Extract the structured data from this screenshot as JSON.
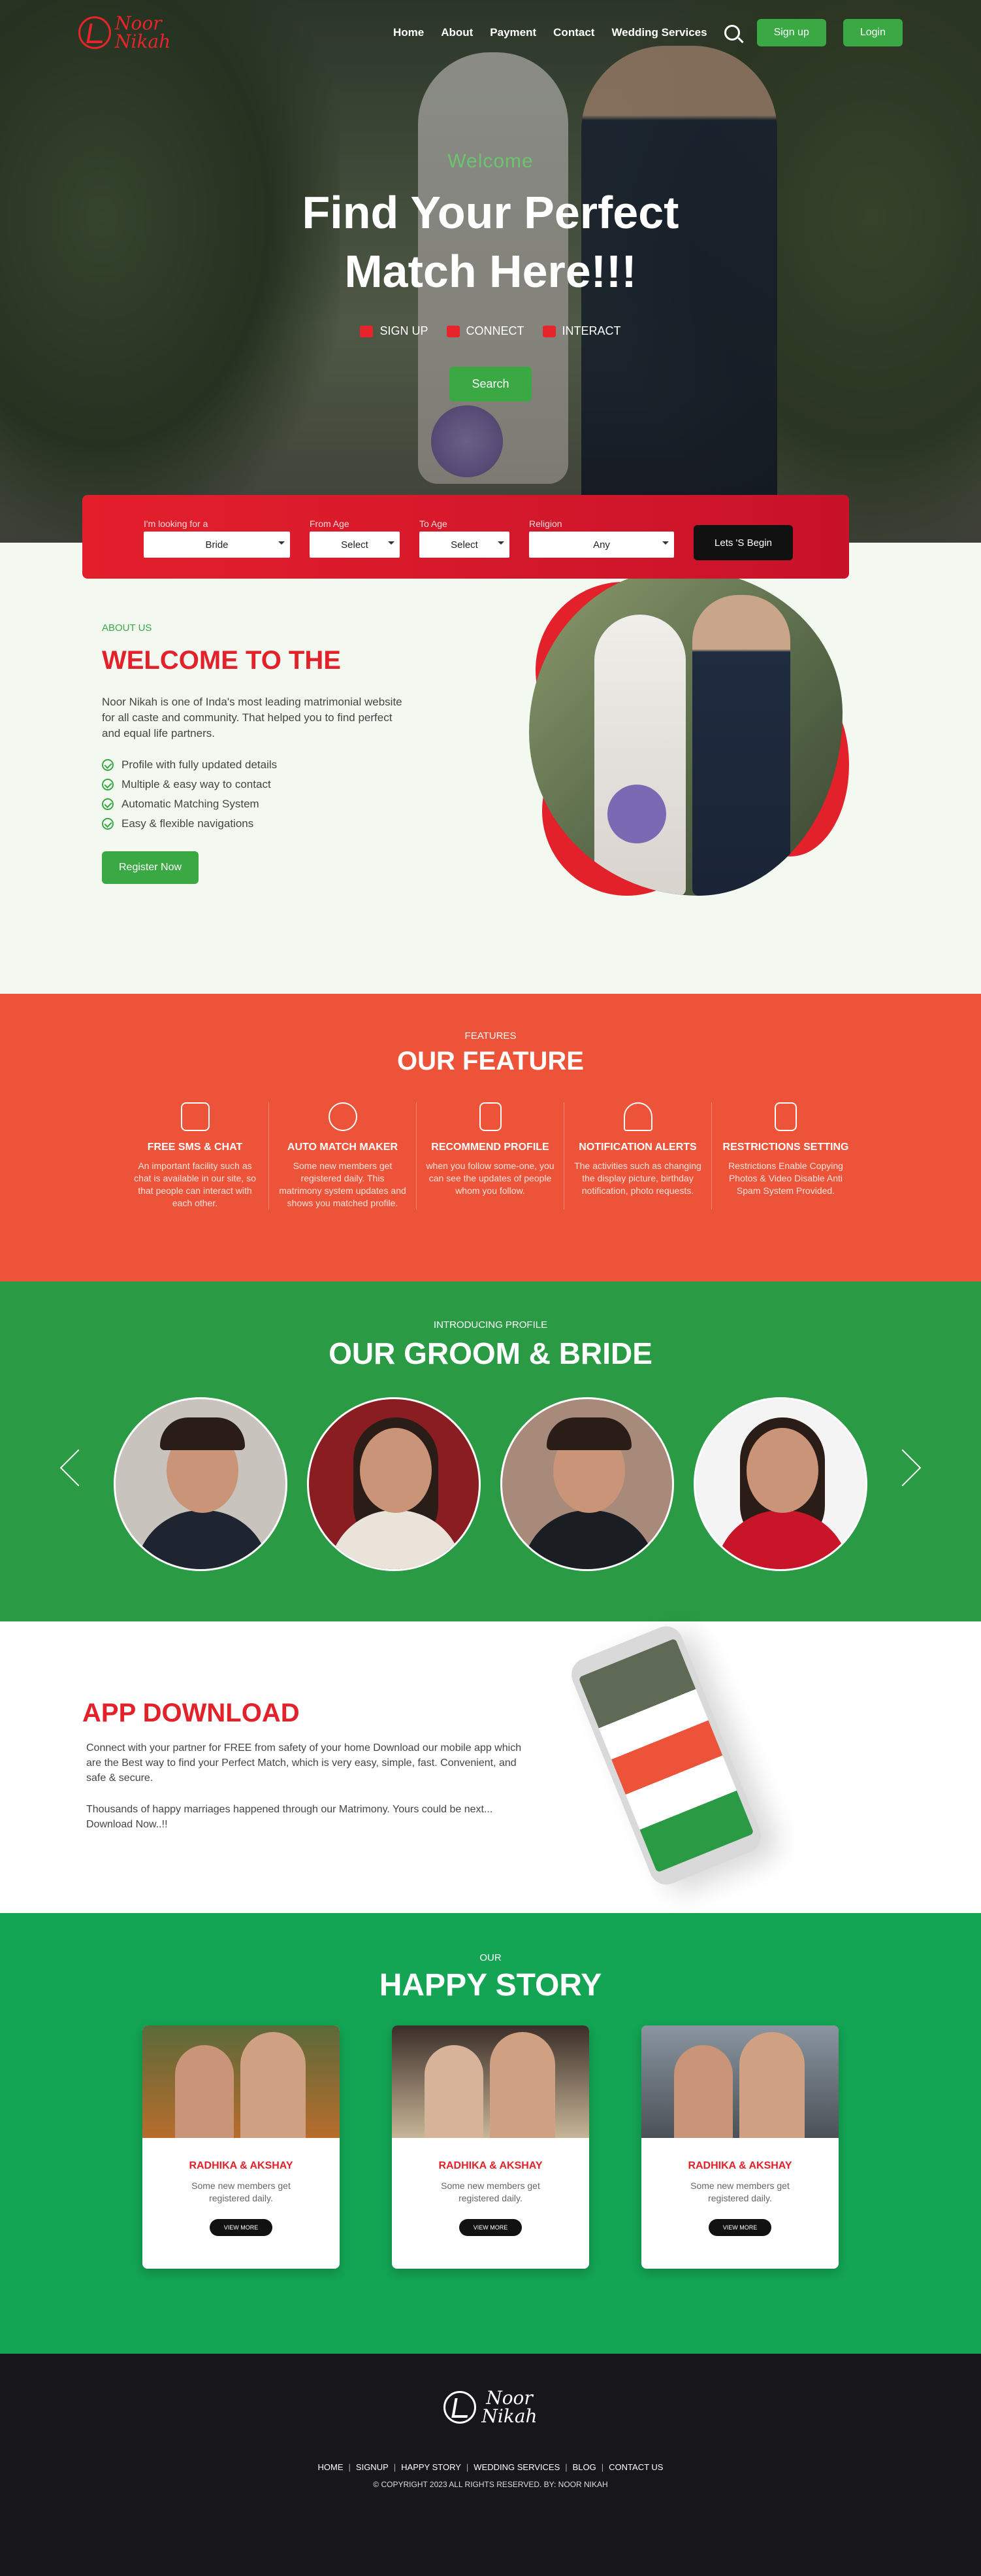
{
  "brand": {
    "line1": "Noor",
    "line2": "Nikah"
  },
  "nav": {
    "items": [
      "Home",
      "About",
      "Payment",
      "Contact",
      "Wedding Services"
    ],
    "signup": "Sign up",
    "login": "Login"
  },
  "hero": {
    "welcome": "Welcome",
    "title_line1": "Find Your Perfect",
    "title_line2": "Match Here!!!",
    "badges": [
      "SIGN UP",
      "CONNECT",
      "INTERACT"
    ],
    "search": "Search"
  },
  "filter": {
    "looking_label": "I'm looking for a",
    "looking_value": "Bride",
    "from_label": "From Age",
    "from_value": "Select",
    "to_label": "To Age",
    "to_value": "Select",
    "religion_label": "Religion",
    "religion_value": "Any",
    "begin": "Lets 'S Begin"
  },
  "about": {
    "eyebrow": "ABOUT US",
    "title": "WELCOME TO THE",
    "desc": "Noor Nikah is one of Inda's most leading matrimonial website for all caste and community. That helped you to find perfect and equal life partners.",
    "points": [
      "Profile with fully updated details",
      "Multiple & easy way to contact",
      "Automatic Matching System",
      "Easy & flexible navigations"
    ],
    "cta": "Register Now"
  },
  "features": {
    "eyebrow": "FEATURES",
    "title": "OUR FEATURE",
    "items": [
      {
        "icon": "sms-chat-icon",
        "title": "FREE SMS & CHAT",
        "text": "An important facility such as chat is available in our site, so that people can interact with each other."
      },
      {
        "icon": "heart-match-icon",
        "title": "AUTO MATCH MAKER",
        "text": "Some new members get registered daily. This matrimony system updates and shows you matched profile."
      },
      {
        "icon": "profile-doc-icon",
        "title": "RECOMMEND PROFILE",
        "text": "when you follow some-one, you can see the updates of people whom you follow."
      },
      {
        "icon": "bell-icon",
        "title": "NOTIFICATION ALERTS",
        "text": "The activities such as changing the display picture, birthday notification, photo requests."
      },
      {
        "icon": "settings-doc-icon",
        "title": "RESTRICTIONS SETTING",
        "text": "Restrictions Enable Copying Photos & Video Disable Anti Spam System Provided."
      }
    ]
  },
  "profiles": {
    "eyebrow": "INTRODUCING PROFILE",
    "title": "OUR GROOM & BRIDE"
  },
  "app": {
    "title": "APP DOWNLOAD",
    "p1": "Connect with your partner for FREE from safety of your home Download our mobile app which are the Best way to find your Perfect Match, which is very easy, simple, fast. Convenient, and safe & secure.",
    "p2": "Thousands of happy marriages happened through our Matrimony. Yours could be next... Download Now..!!"
  },
  "story": {
    "eyebrow": "OUR",
    "title": "HAPPY STORY",
    "cards": [
      {
        "name": "RADHIKA & AKSHAY",
        "text": "Some new members get registered daily.",
        "more": "VIEW MORE"
      },
      {
        "name": "RADHIKA & AKSHAY",
        "text": "Some new members get registered daily.",
        "more": "VIEW MORE"
      },
      {
        "name": "RADHIKA & AKSHAY",
        "text": "Some new members get registered daily.",
        "more": "VIEW MORE"
      }
    ]
  },
  "footer": {
    "links": [
      "HOME",
      "SIGNUP",
      "HAPPY STORY",
      "WEDDING SERVICES",
      "BLOG",
      "CONTACT US"
    ],
    "copyright": "© COPYRIGHT 2023 ALL RIGHTS RESERVED. BY: NOOR NIKAH"
  },
  "colors": {
    "red": "#e2212a",
    "green": "#3aa843",
    "feature_bg": "#ec5338",
    "groom_bg": "#2a9a45",
    "story_bg": "#13a454",
    "footer_bg": "#17171a"
  }
}
